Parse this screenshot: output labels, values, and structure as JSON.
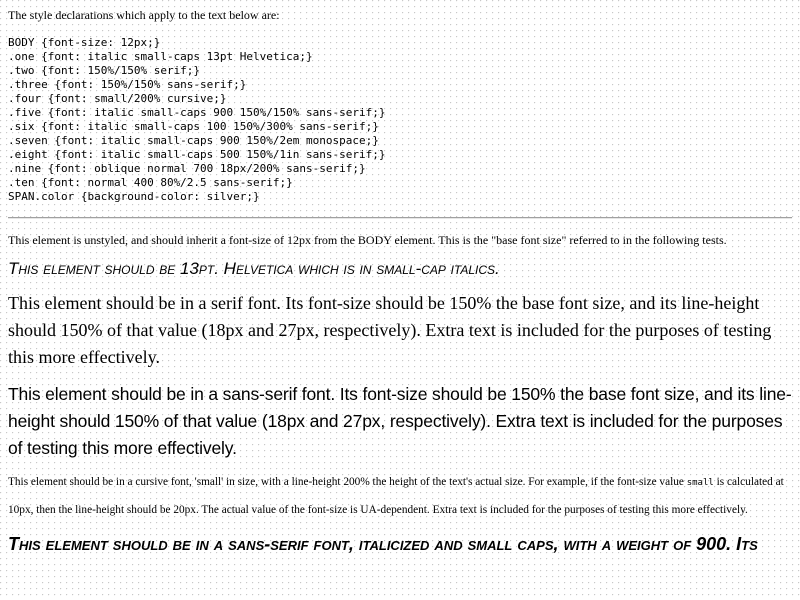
{
  "intro": "The style declarations which apply to the text below are:",
  "css_rules": [
    "BODY {font-size: 12px;}",
    ".one {font: italic small-caps 13pt Helvetica;}",
    ".two {font: 150%/150% serif;}",
    ".three {font: 150%/150% sans-serif;}",
    ".four {font: small/200% cursive;}",
    ".five {font: italic small-caps 900 150%/150% sans-serif;}",
    ".six {font: italic small-caps 100 150%/300% sans-serif;}",
    ".seven {font: italic small-caps 900 150%/2em monospace;}",
    ".eight {font: italic small-caps 500 150%/1in sans-serif;}",
    ".nine {font: oblique normal 700 18px/200% sans-serif;}",
    ".ten {font: normal 400 80%/2.5 sans-serif;}",
    "SPAN.color {background-color: silver;}"
  ],
  "paragraphs": {
    "base": "This element is unstyled, and should inherit a font-size of 12px from the BODY element. This is the \"base font size\" referred to in the following tests.",
    "one": "This element should be 13pt. Helvetica which is in small-cap italics.",
    "two": "This element should be in a serif font. Its font-size should be 150% the base font size, and its line-height should 150% of that value (18px and 27px, respectively). Extra text is included for the purposes of testing this more effectively.",
    "three": "This element should be in a sans-serif font. Its font-size should be 150% the base font size, and its line-height should 150% of that value (18px and 27px, respectively). Extra text is included for the purposes of testing this more effectively.",
    "four_before": "This element should be in a cursive font, 'small' in size, with a line-height 200% the height of the text's actual size. For example, if the font-size value ",
    "four_code": "small",
    "four_after": " is calculated at 10px, then the line-height should be 20px. The actual value of the font-size is UA-dependent. Extra text is included for the purposes of testing this more effectively.",
    "five": "This element should be in a sans-serif font, italicized and small caps, with a weight of 900. Its"
  }
}
